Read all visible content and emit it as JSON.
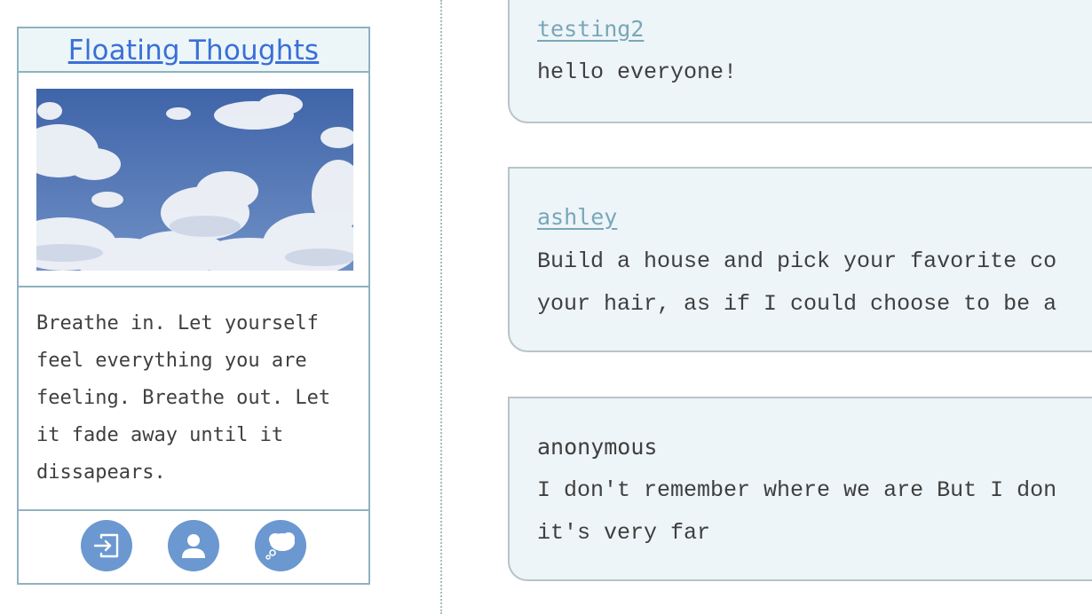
{
  "sidebar": {
    "title": "Floating Thoughts",
    "quote": "Breathe in. Let yourself\nfeel everything you are\nfeeling. Breathe out. Let\nit fade away until it\ndissapears.",
    "icons": [
      "login-icon",
      "profile-icon",
      "thought-bubble-icon"
    ]
  },
  "posts": [
    {
      "author": "testing2",
      "author_linked": true,
      "body": "hello everyone!"
    },
    {
      "author": "ashley",
      "author_linked": true,
      "body": "Build a house and pick your favorite co\nyour hair, as if I could choose to be a"
    },
    {
      "author": "anonymous",
      "author_linked": false,
      "body": "I don't remember where we are But I don\nit's very far"
    }
  ],
  "colors": {
    "accent": "#6b98d0",
    "link": "#3a6fd8",
    "border": "#8fb2c0",
    "post_bg": "#edf5f8"
  }
}
